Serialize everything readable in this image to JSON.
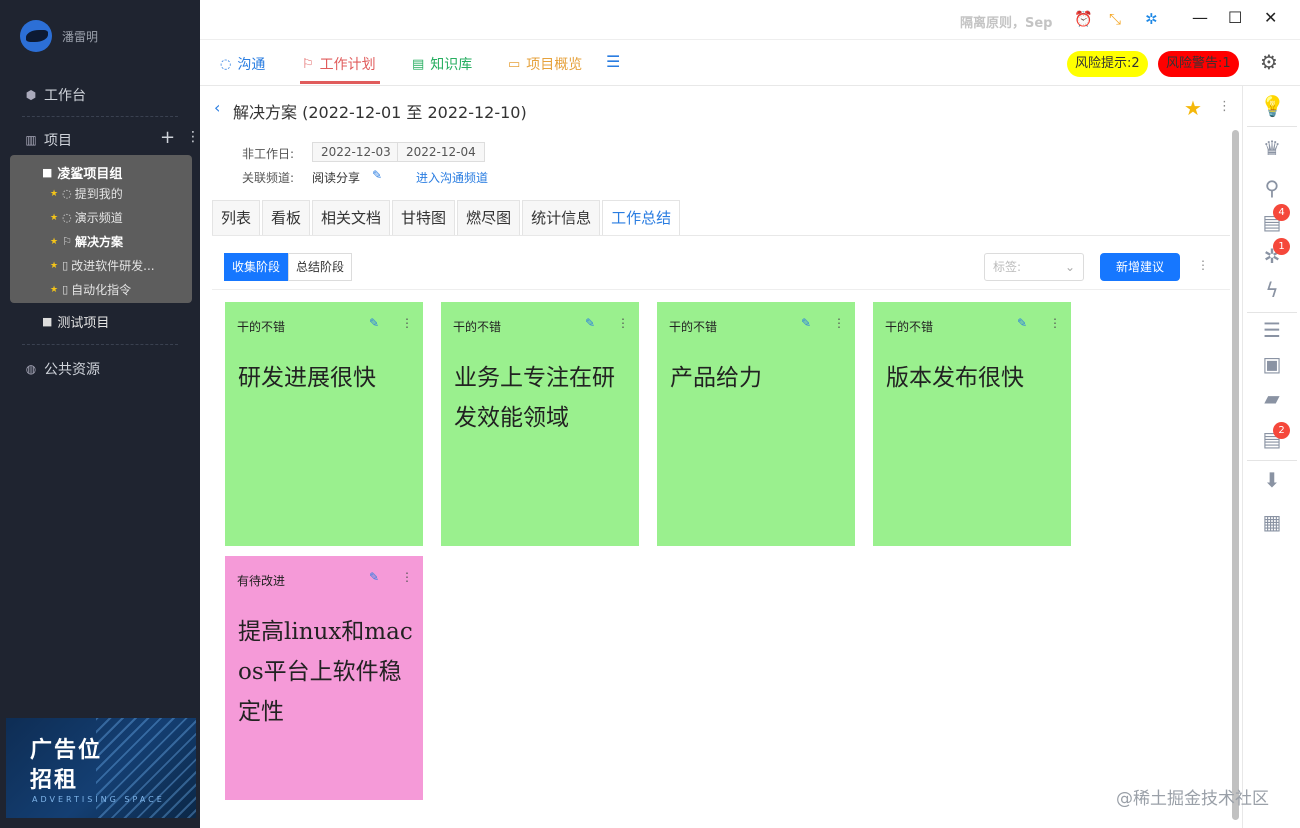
{
  "sidebar": {
    "user_name": "潘雷明",
    "workbench": "工作台",
    "projects": "项目",
    "group": {
      "title": "凌鲨项目组",
      "items": [
        {
          "label": "提到我的",
          "icon": "chat-icon"
        },
        {
          "label": "演示频道",
          "icon": "chat-icon"
        },
        {
          "label": "解决方案",
          "icon": "flag-icon"
        },
        {
          "label": "改进软件研发...",
          "icon": "doc-icon"
        },
        {
          "label": "自动化指令",
          "icon": "doc-icon"
        }
      ]
    },
    "test_project": "测试项目",
    "public": "公共资源",
    "ad": {
      "line1": "广告位",
      "line2": "招租",
      "line3": "ADVERTISING SPACE"
    }
  },
  "titlebar": {
    "search_text": "隔离原则，Sep"
  },
  "nav": {
    "tabs": [
      "沟通",
      "工作计划",
      "知识库",
      "项目概览"
    ],
    "risk_hint": "风险提示:2",
    "risk_alert": "风险警告:1"
  },
  "plan": {
    "title": "解决方案 (2022-12-01 至 2022-12-10)",
    "non_workday_label": "非工作日:",
    "non_workdays": [
      "2022-12-03",
      "2022-12-04"
    ],
    "channel_label": "关联频道:",
    "channel_value": "阅读分享",
    "channel_link": "进入沟通频道"
  },
  "tabs": [
    "列表",
    "看板",
    "相关文档",
    "甘特图",
    "燃尽图",
    "统计信息",
    "工作总结"
  ],
  "stages": [
    "收集阶段",
    "总结阶段"
  ],
  "tag_placeholder": "标签:",
  "new_button": "新增建议",
  "cards": [
    {
      "tag": "干的不错",
      "text": "研发进展很快"
    },
    {
      "tag": "干的不错",
      "text": "业务上专注在研发效能领域"
    },
    {
      "tag": "干的不错",
      "text": "产品给力"
    },
    {
      "tag": "干的不错",
      "text": "版本发布很快"
    },
    {
      "tag": "有待改进",
      "text": "提高linux和macos平台上软件稳定性"
    }
  ],
  "rail_badges": {
    "doc": "4",
    "bug": "1",
    "request": "2"
  },
  "watermark": "@稀土掘金技术社区",
  "colors": {
    "accent": "#1677ff",
    "card_good": "#9af08e",
    "card_improve": "#f59ad8",
    "sidebar_bg": "#1f2430"
  }
}
